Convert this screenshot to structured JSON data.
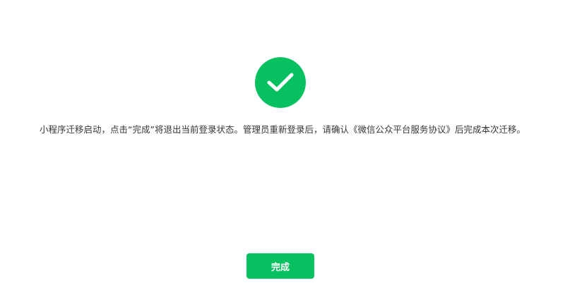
{
  "result": {
    "icon": "check-circle-icon",
    "accent_color": "#07c160"
  },
  "message": {
    "text": "小程序迁移启动，点击“完成”将退出当前登录状态。管理员重新登录后，请确认《微信公众平台服务协议》后完成本次迁移。"
  },
  "actions": {
    "done_label": "完成"
  }
}
